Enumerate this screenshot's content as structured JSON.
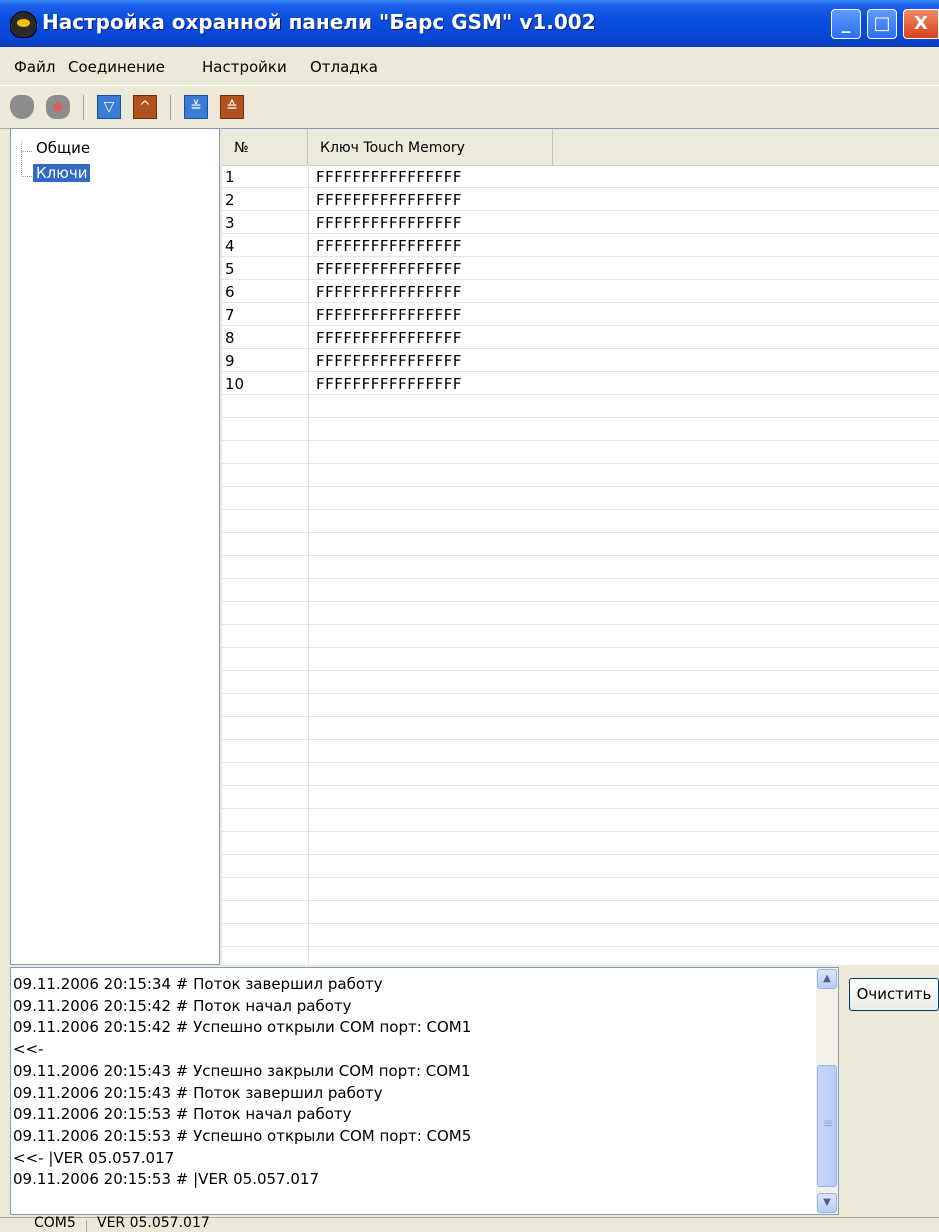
{
  "window": {
    "title": "Настройка охранной панели \"Барс GSM\" v1.002",
    "controls": {
      "minimize": "_",
      "maximize": "□",
      "close": "X"
    }
  },
  "menu": [
    "Файл",
    "Соединение",
    "Настройки",
    "Отладка"
  ],
  "toolbar": {
    "buttons": [
      "connect-icon",
      "disconnect-icon",
      "read-icon",
      "write-icon",
      "read-all-icon",
      "write-all-icon"
    ]
  },
  "tree": {
    "items": [
      {
        "label": "Общие",
        "selected": false
      },
      {
        "label": "Ключи",
        "selected": true
      }
    ]
  },
  "grid": {
    "columns": [
      "№",
      "Ключ Touch Memory"
    ],
    "rows": [
      [
        "1",
        "FFFFFFFFFFFFFFFF"
      ],
      [
        "2",
        "FFFFFFFFFFFFFFFF"
      ],
      [
        "3",
        "FFFFFFFFFFFFFFFF"
      ],
      [
        "4",
        "FFFFFFFFFFFFFFFF"
      ],
      [
        "5",
        "FFFFFFFFFFFFFFFF"
      ],
      [
        "6",
        "FFFFFFFFFFFFFFFF"
      ],
      [
        "7",
        "FFFFFFFFFFFFFFFF"
      ],
      [
        "8",
        "FFFFFFFFFFFFFFFF"
      ],
      [
        "9",
        "FFFFFFFFFFFFFFFF"
      ],
      [
        "10",
        "FFFFFFFFFFFFFFFF"
      ]
    ]
  },
  "log": {
    "lines": [
      "09.11.2006 20:15:34  # Поток завершил работу",
      "09.11.2006 20:15:42  # Поток начал работу",
      "09.11.2006 20:15:42  # Успешно открыли COM порт: COM1",
      "<<-",
      "09.11.2006 20:15:43  # Успешно закрыли COM порт: COM1",
      "09.11.2006 20:15:43  # Поток завершил работу",
      "09.11.2006 20:15:53  # Поток начал работу",
      "09.11.2006 20:15:53  # Успешно открыли COM порт: COM5",
      "<<- |VER 05.057.017",
      "09.11.2006 20:15:53  # |VER 05.057.017"
    ],
    "clear_label": "Очистить"
  },
  "status": {
    "port": "COM5",
    "version": "VER 05.057.017"
  }
}
